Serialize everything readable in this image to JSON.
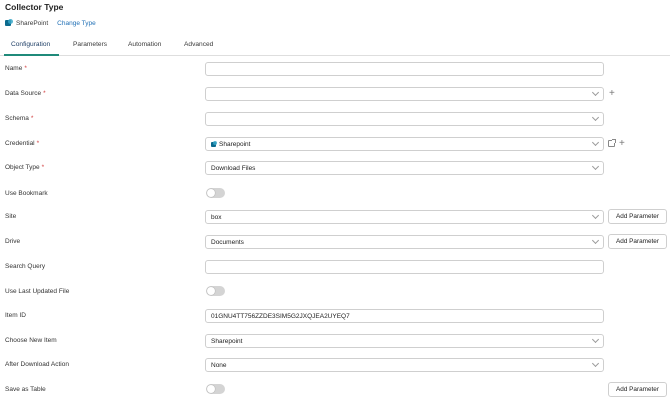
{
  "header": {
    "title": "Collector Type",
    "collector_name": "SharePoint",
    "change_type": "Change Type"
  },
  "tabs": [
    {
      "label": "Configuration",
      "active": true
    },
    {
      "label": "Parameters",
      "active": false
    },
    {
      "label": "Automation",
      "active": false
    },
    {
      "label": "Advanced",
      "active": false
    }
  ],
  "form": {
    "name": {
      "label": "Name",
      "value": ""
    },
    "data_source": {
      "label": "Data Source",
      "value": ""
    },
    "schema": {
      "label": "Schema",
      "value": ""
    },
    "credential": {
      "label": "Credential",
      "value": "Sharepoint"
    },
    "object_type": {
      "label": "Object Type",
      "value": "Download Files"
    },
    "use_bookmark": {
      "label": "Use Bookmark",
      "on": false
    },
    "site": {
      "label": "Site",
      "value": "box"
    },
    "drive": {
      "label": "Drive",
      "value": "Documents"
    },
    "search_query": {
      "label": "Search Query",
      "value": ""
    },
    "use_last_updated": {
      "label": "Use Last Updated File",
      "on": false
    },
    "item_id": {
      "label": "Item ID",
      "value": "01GNU4TT756ZZDE3SIM5G2JXQJEA2UYEQ7"
    },
    "choose_new_item": {
      "label": "Choose New Item",
      "value": "Sharepoint"
    },
    "after_download": {
      "label": "After Download Action",
      "value": "None"
    },
    "save_as_table": {
      "label": "Save as Table",
      "on": false
    }
  },
  "buttons": {
    "add_parameter": "Add Parameter",
    "plus": "+"
  },
  "required_marker": "*",
  "colors": {
    "accent": "#1f8a7a",
    "link": "#1f6fb5",
    "required": "#d13b3b",
    "toggle_off": "#d4d4d4"
  }
}
